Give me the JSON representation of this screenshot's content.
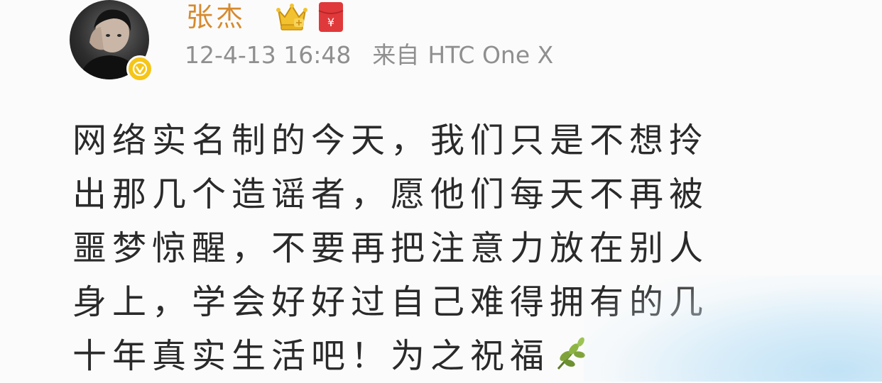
{
  "post": {
    "author": "张杰",
    "timestamp": "12-4-13 16:48",
    "source_prefix": "来自",
    "source_device": "HTC One X",
    "lines": [
      "网络实名制的今天，我们只是不想拎",
      "出那几个造谣者，愿他们每天不再被",
      "噩梦惊醒，不要再把注意力放在别人",
      "身上，学会好好过自己难得拥有的几",
      "十年真实生活吧！为之祝福"
    ]
  },
  "icons": {
    "verified": "verified-badge-icon",
    "crown": "vip-crown-icon",
    "red_packet": "red-packet-icon",
    "emoji": "plant-emoji-icon"
  },
  "colors": {
    "username": "#d68a2e",
    "meta": "#8f8f8f",
    "text": "#2a2a2a",
    "verified": "#f5c518",
    "red_packet": "#e0393b"
  }
}
